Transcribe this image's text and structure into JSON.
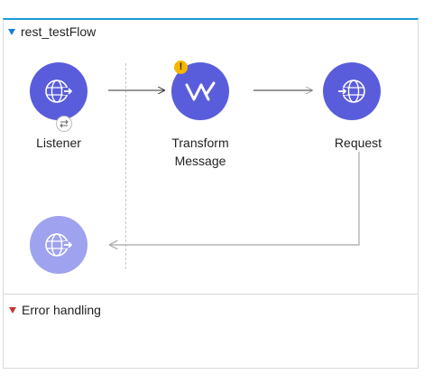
{
  "flow": {
    "name": "rest_testFlow",
    "accent_color": "#1b9bd7"
  },
  "nodes": {
    "listener": {
      "label": "Listener",
      "icon": "globe-inbound-icon",
      "badge": "sync-icon"
    },
    "transform": {
      "label_line1": "Transform",
      "label_line2": "Message",
      "icon": "dataweave-icon",
      "warning": "!"
    },
    "request": {
      "label": "Request",
      "icon": "globe-outbound-icon"
    },
    "response": {
      "icon": "globe-inbound-icon"
    }
  },
  "error_handling": {
    "label": "Error handling"
  },
  "colors": {
    "node_fill": "#5a5ddb",
    "node_fill_faded": "#9fa2ee",
    "warning": "#f5b700",
    "error_caret": "#c0392b"
  }
}
